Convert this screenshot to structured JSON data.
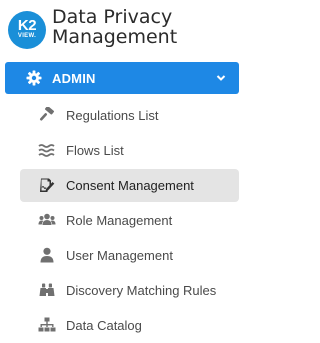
{
  "brand": {
    "logo_line1": "K2",
    "logo_line2": "VIEW.",
    "title_line1": "Data Privacy",
    "title_line2": "Management"
  },
  "admin": {
    "label": "ADMIN",
    "icon": "gear-icon",
    "expanded": true,
    "color": "#1e88e5"
  },
  "nav": {
    "items": [
      {
        "label": "Regulations List",
        "icon": "gavel-icon",
        "active": false
      },
      {
        "label": "Flows List",
        "icon": "waves-icon",
        "active": false
      },
      {
        "label": "Consent Management",
        "icon": "signature-icon",
        "active": true
      },
      {
        "label": "Role Management",
        "icon": "users-icon",
        "active": false
      },
      {
        "label": "User Management",
        "icon": "user-icon",
        "active": false
      },
      {
        "label": "Discovery Matching Rules",
        "icon": "binoculars-icon",
        "active": false
      },
      {
        "label": "Data Catalog",
        "icon": "sitemap-icon",
        "active": false
      }
    ]
  },
  "colors": {
    "icon_gray": "#707070",
    "active_bg": "#e4e4e4",
    "logo_blue": "#1a8fd8"
  }
}
